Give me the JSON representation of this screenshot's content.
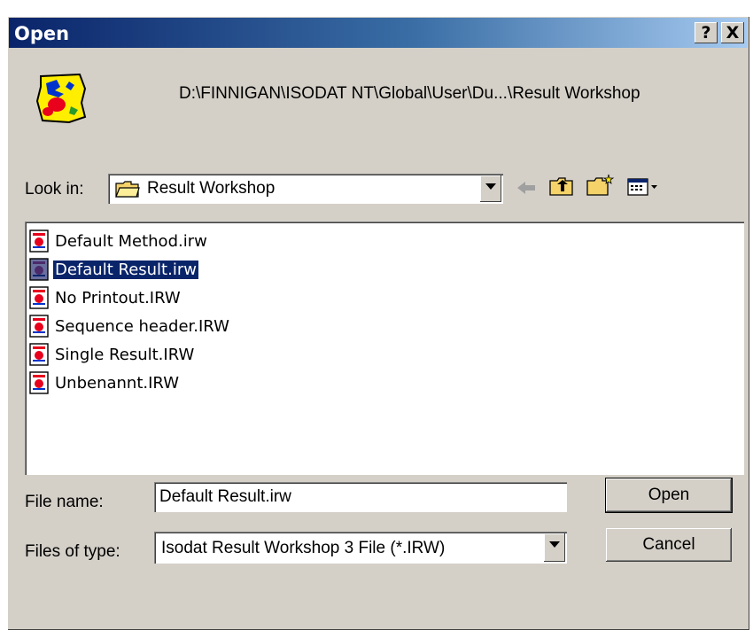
{
  "dialog": {
    "title": "Open",
    "help_button": "?",
    "close_button": "X",
    "path": "D:\\FINNIGAN\\ISODAT NT\\Global\\User\\Du...\\Result Workshop"
  },
  "look_in": {
    "label": "Look in:",
    "value": "Result Workshop"
  },
  "files": [
    {
      "name": "Default Method.irw"
    },
    {
      "name": "Default Result.irw",
      "selected": true
    },
    {
      "name": "No Printout.IRW"
    },
    {
      "name": "Sequence header.IRW"
    },
    {
      "name": "Single Result.IRW"
    },
    {
      "name": "Unbenannt.IRW"
    }
  ],
  "file_name": {
    "label": "File name:",
    "value": "Default Result.irw"
  },
  "files_of_type": {
    "label": "Files of type:",
    "value": "Isodat Result Workshop 3  File (*.IRW)"
  },
  "buttons": {
    "open": "Open",
    "cancel": "Cancel"
  },
  "icons": [
    "app-map-icon",
    "folder-icon",
    "back-arrow-icon",
    "up-folder-icon",
    "new-folder-icon",
    "view-menu-icon",
    "chevron-down-icon",
    "irw-file-icon"
  ],
  "colors": {
    "title_start": "#0a246a",
    "title_end": "#a6caf0",
    "face": "#d4d0c8",
    "selection": "#0a246a"
  }
}
